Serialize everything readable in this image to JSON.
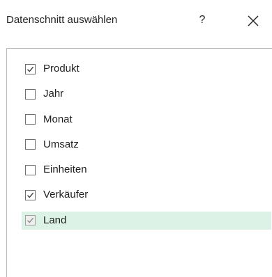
{
  "dialog": {
    "title": "Datenschnitt auswählen",
    "help_label": "?",
    "close_icon": "close-icon"
  },
  "fields": [
    {
      "label": "Produkt",
      "checked": true,
      "disabled": false,
      "selected": false
    },
    {
      "label": "Jahr",
      "checked": false,
      "disabled": false,
      "selected": false
    },
    {
      "label": "Monat",
      "checked": false,
      "disabled": false,
      "selected": false
    },
    {
      "label": "Umsatz",
      "checked": false,
      "disabled": false,
      "selected": false
    },
    {
      "label": "Einheiten",
      "checked": false,
      "disabled": false,
      "selected": false
    },
    {
      "label": "Verkäufer",
      "checked": true,
      "disabled": false,
      "selected": false
    },
    {
      "label": "Land",
      "checked": true,
      "disabled": true,
      "selected": true
    }
  ],
  "colors": {
    "selection_background": "#ddf2e6",
    "checkbox_border": "#6e6e6e",
    "checkmark": "#3c3c3c",
    "checkmark_disabled": "#8a8a8a"
  }
}
